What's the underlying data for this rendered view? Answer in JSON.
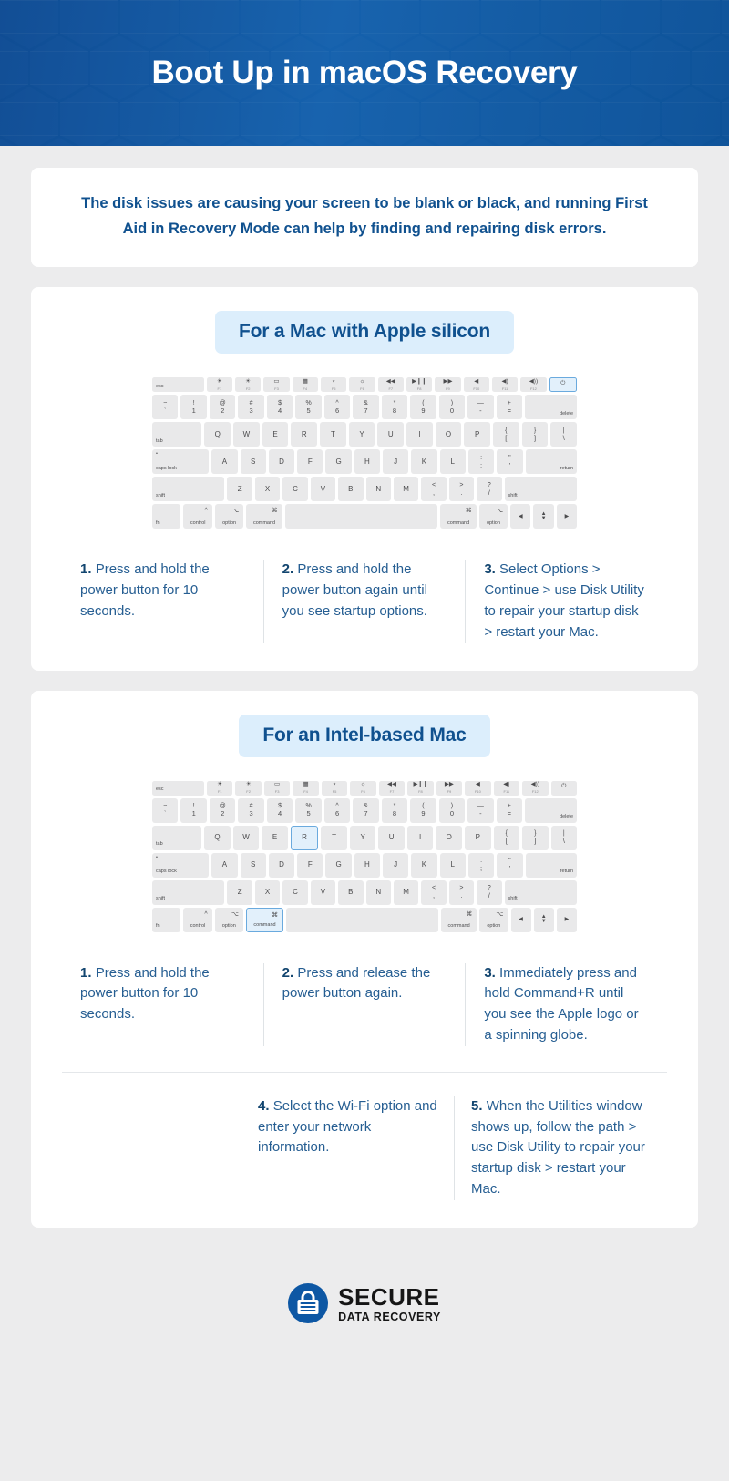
{
  "header": {
    "title": "Boot Up in macOS Recovery"
  },
  "intro": {
    "text": "The disk issues are causing your screen to be blank or black, and running First Aid in Recovery Mode can help by finding and repairing disk errors."
  },
  "sections": [
    {
      "pill_label": "For a Mac with Apple silicon",
      "keyboard": {
        "highlight": "power"
      },
      "steps": [
        {
          "num": "1.",
          "text": "Press and hold the power button for 10 seconds."
        },
        {
          "num": "2.",
          "text": "Press and hold the power button again until you see startup options."
        },
        {
          "num": "3.",
          "text": "Select Options > Continue > use Disk Utility to repair your startup disk > restart your Mac."
        }
      ]
    },
    {
      "pill_label": "For an Intel-based Mac",
      "keyboard": {
        "highlight": "command-r"
      },
      "steps": [
        {
          "num": "1.",
          "text": "Press and hold the power button for 10 seconds."
        },
        {
          "num": "2.",
          "text": "Press and release the power button again."
        },
        {
          "num": "3.",
          "text": "Immediately press and hold Command+R until you see the Apple logo or a spinning globe."
        }
      ],
      "steps2": [
        {
          "num": "4.",
          "text": "Select the Wi-Fi option and enter your network information."
        },
        {
          "num": "5.",
          "text": "When the Utilities window shows up, follow the path > use Disk Utility to repair your startup disk > restart your Mac."
        }
      ]
    }
  ],
  "keyboard_layout": {
    "fn_row": [
      {
        "label": "esc",
        "fn": "",
        "type": "wide-esc"
      },
      {
        "icon": "brightness-down-icon",
        "glyph": "☀",
        "fn": "F1"
      },
      {
        "icon": "brightness-up-icon",
        "glyph": "☀",
        "fn": "F2"
      },
      {
        "icon": "mission-control-icon",
        "glyph": "▭",
        "fn": "F3"
      },
      {
        "icon": "launchpad-icon",
        "glyph": "▦",
        "fn": "F4"
      },
      {
        "icon": "keyboard-backlight-down-icon",
        "glyph": "٭",
        "fn": "F5"
      },
      {
        "icon": "keyboard-backlight-up-icon",
        "glyph": "☼",
        "fn": "F6"
      },
      {
        "icon": "rewind-icon",
        "glyph": "◀◀",
        "fn": "F7"
      },
      {
        "icon": "play-pause-icon",
        "glyph": "▶❙❙",
        "fn": "F8"
      },
      {
        "icon": "fast-forward-icon",
        "glyph": "▶▶",
        "fn": "F9"
      },
      {
        "icon": "mute-icon",
        "glyph": "◀",
        "fn": "F10"
      },
      {
        "icon": "volume-down-icon",
        "glyph": "◀)",
        "fn": "F11"
      },
      {
        "icon": "volume-up-icon",
        "glyph": "◀))",
        "fn": "F12"
      },
      {
        "icon": "power-icon",
        "glyph": "⏻",
        "fn": "",
        "key": "power"
      }
    ],
    "number_row": [
      {
        "top": "~",
        "bot": "`"
      },
      {
        "top": "!",
        "bot": "1"
      },
      {
        "top": "@",
        "bot": "2"
      },
      {
        "top": "#",
        "bot": "3"
      },
      {
        "top": "$",
        "bot": "4"
      },
      {
        "top": "%",
        "bot": "5"
      },
      {
        "top": "^",
        "bot": "6"
      },
      {
        "top": "&",
        "bot": "7"
      },
      {
        "top": "*",
        "bot": "8"
      },
      {
        "top": "(",
        "bot": "9"
      },
      {
        "top": ")",
        "bot": "0"
      },
      {
        "top": "—",
        "bot": "-"
      },
      {
        "top": "+",
        "bot": "="
      },
      {
        "label": "delete"
      }
    ],
    "top_row": [
      {
        "label": "tab"
      },
      {
        "label": "Q"
      },
      {
        "label": "W"
      },
      {
        "label": "E"
      },
      {
        "label": "R",
        "key": "r"
      },
      {
        "label": "T"
      },
      {
        "label": "Y"
      },
      {
        "label": "U"
      },
      {
        "label": "I"
      },
      {
        "label": "O"
      },
      {
        "label": "P"
      },
      {
        "top": "{",
        "bot": "["
      },
      {
        "top": "}",
        "bot": "]"
      },
      {
        "top": "|",
        "bot": "\\"
      }
    ],
    "home_row": [
      {
        "label": "caps lock"
      },
      {
        "label": "A"
      },
      {
        "label": "S"
      },
      {
        "label": "D"
      },
      {
        "label": "F"
      },
      {
        "label": "G"
      },
      {
        "label": "H"
      },
      {
        "label": "J"
      },
      {
        "label": "K"
      },
      {
        "label": "L"
      },
      {
        "top": ":",
        "bot": ";"
      },
      {
        "top": "\"",
        "bot": "'"
      },
      {
        "label": "return"
      }
    ],
    "bottom_row": [
      {
        "label": "shift"
      },
      {
        "label": "Z"
      },
      {
        "label": "X"
      },
      {
        "label": "C"
      },
      {
        "label": "V"
      },
      {
        "label": "B"
      },
      {
        "label": "N"
      },
      {
        "label": "M"
      },
      {
        "top": "<",
        "bot": ","
      },
      {
        "top": ">",
        "bot": "."
      },
      {
        "top": "?",
        "bot": "/"
      },
      {
        "label": "shift"
      }
    ],
    "mod_row": [
      {
        "label": "fn"
      },
      {
        "sym": "^",
        "name": "control"
      },
      {
        "sym": "⌥",
        "name": "option"
      },
      {
        "sym": "⌘",
        "name": "command",
        "key": "command"
      },
      {
        "label": ""
      },
      {
        "sym": "⌘",
        "name": "command"
      },
      {
        "sym": "⌥",
        "name": "option"
      },
      {
        "label": "◀"
      },
      {
        "label": "▲",
        "sub": "▼"
      },
      {
        "label": "▶"
      }
    ]
  },
  "footer": {
    "logo_icon": "lock-shield-icon",
    "logo_top": "SECURE",
    "logo_bottom": "DATA RECOVERY"
  },
  "colors": {
    "header_blue": "#1561ad",
    "accent_blue": "#10518f",
    "pill_bg": "#dceefc",
    "step_text": "#265e92",
    "key_bg": "#e9e9ea",
    "key_highlight_bg": "#e2f0fb",
    "key_highlight_border": "#6aaade",
    "page_bg": "#ececed"
  }
}
